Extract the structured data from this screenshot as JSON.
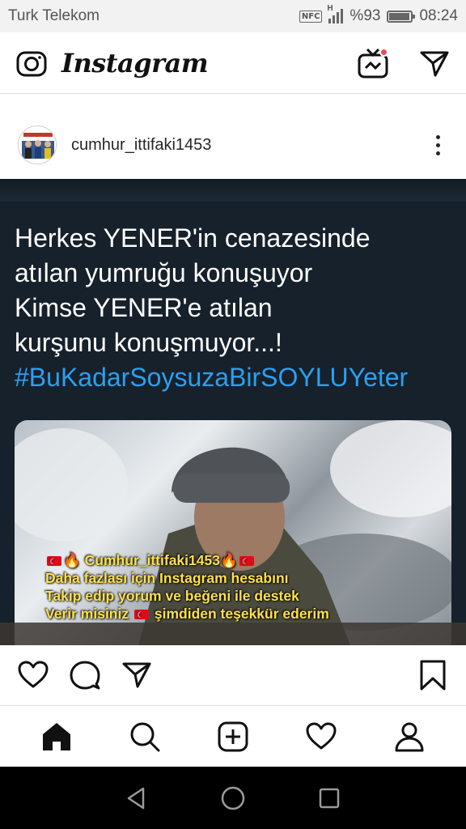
{
  "status_bar": {
    "carrier": "Turk Telekom",
    "nfc": "NFC",
    "network": "H",
    "battery_text": "%93",
    "battery_level": 0.93,
    "time": "08:24"
  },
  "header": {
    "app_name": "Instagram",
    "icons": [
      "camera-icon",
      "igtv-icon",
      "direct-message-icon"
    ]
  },
  "post": {
    "username": "cumhur_ittifaki1453",
    "tweet_lines": [
      "Herkes YENER'in cenazesinde",
      "atılan yumruğu konuşuyor",
      "Kimse YENER'e atılan",
      "kurşunu konuşmuyor...!"
    ],
    "hashtag": "#BuKadarSoysuzaBirSOYLUYeter",
    "overlay": {
      "handle": "Cumhur_ittifaki1453",
      "line2": "Daha fazlası için Instagram hesabını",
      "line3": "Takip edip yorum ve beğeni ile destek",
      "line4_a": "Verir misiniz",
      "line4_b": "şimdiden teşekkür ederim"
    },
    "actions": [
      "like-icon",
      "comment-icon",
      "share-icon",
      "bookmark-icon"
    ]
  },
  "bottom_nav": [
    "home-icon",
    "search-icon",
    "new-post-icon",
    "activity-icon",
    "profile-icon"
  ],
  "android_nav": [
    "back-icon",
    "home-circle-icon",
    "recents-icon"
  ],
  "colors": {
    "hashtag": "#2c9ff0",
    "overlay_text": "#ffe14a",
    "notification_dot": "#ed4956",
    "post_bg": "#17212b"
  }
}
